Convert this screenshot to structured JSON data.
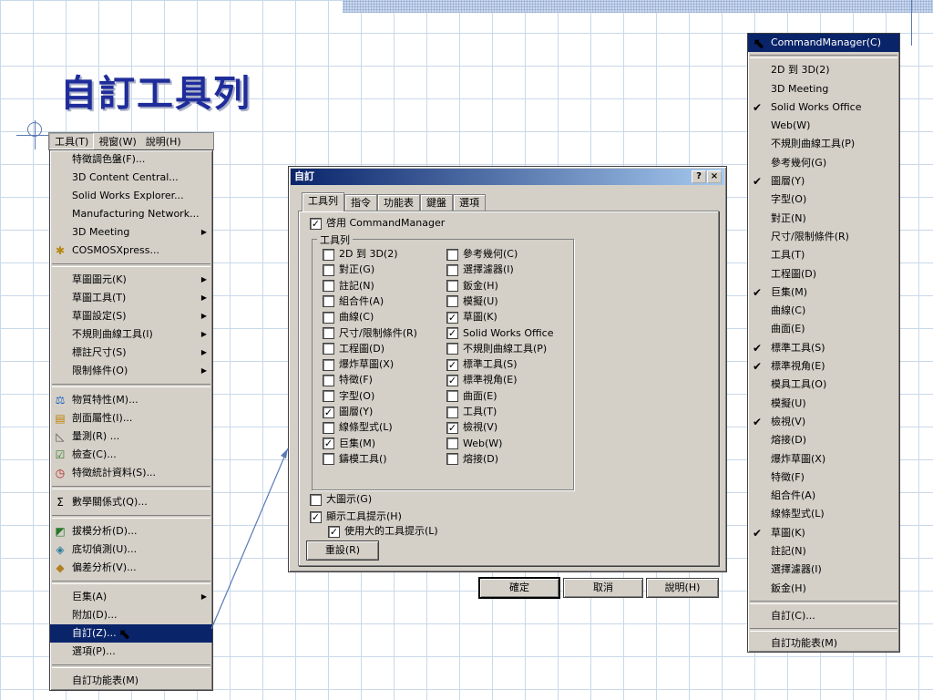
{
  "slide": {
    "title": "自訂工具列"
  },
  "menubar": {
    "items": [
      "工具(T)",
      "視窗(W)",
      "說明(H)"
    ]
  },
  "tools_menu": {
    "groups": [
      [
        {
          "label": "特徵調色盤(F)..."
        },
        {
          "label": "3D Content Central..."
        },
        {
          "label": "Solid Works Explorer..."
        },
        {
          "label": "Manufacturing Network..."
        },
        {
          "label": "3D Meeting",
          "submenu": true
        },
        {
          "label": "COSMOSXpress...",
          "icon": "cosmos-icon"
        }
      ],
      [
        {
          "label": "草圖圖元(K)",
          "submenu": true
        },
        {
          "label": "草圖工具(T)",
          "submenu": true
        },
        {
          "label": "草圖設定(S)",
          "submenu": true
        },
        {
          "label": "不規則曲線工具(I)",
          "submenu": true
        },
        {
          "label": "標註尺寸(S)",
          "submenu": true
        },
        {
          "label": "限制條件(O)",
          "submenu": true
        }
      ],
      [
        {
          "label": "物質特性(M)...",
          "icon": "mass-properties-icon"
        },
        {
          "label": "剖面屬性(I)...",
          "icon": "section-properties-icon"
        },
        {
          "label": "量測(R) ...",
          "icon": "measure-icon"
        },
        {
          "label": "檢查(C)...",
          "icon": "check-icon"
        },
        {
          "label": "特徵統計資料(S)...",
          "icon": "statistics-icon"
        }
      ],
      [
        {
          "label": "數學關係式(Q)...",
          "icon": "sigma-icon"
        }
      ],
      [
        {
          "label": "拔模分析(D)...",
          "icon": "draft-analysis-icon"
        },
        {
          "label": "底切偵測(U)...",
          "icon": "undercut-icon"
        },
        {
          "label": "偏差分析(V)...",
          "icon": "deviation-icon"
        }
      ],
      [
        {
          "label": "巨集(A)",
          "submenu": true
        },
        {
          "label": "附加(D)..."
        },
        {
          "label": "自訂(Z)...",
          "highlight": true
        },
        {
          "label": "選項(P)..."
        }
      ],
      [
        {
          "label": "自訂功能表(M)"
        }
      ]
    ]
  },
  "dialog": {
    "title": "自訂",
    "help_btn": "?",
    "close_btn": "×",
    "tabs": [
      "工具列",
      "指令",
      "功能表",
      "鍵盤",
      "選項"
    ],
    "enable_cm": {
      "label": "啓用 CommandManager",
      "checked": true
    },
    "group_label": "工具列",
    "toolbars_left": [
      {
        "label": "2D 到 3D(2)",
        "checked": false
      },
      {
        "label": "對正(G)",
        "checked": false
      },
      {
        "label": "註記(N)",
        "checked": false
      },
      {
        "label": "組合件(A)",
        "checked": false
      },
      {
        "label": "曲線(C)",
        "checked": false
      },
      {
        "label": "尺寸/限制條件(R)",
        "checked": false
      },
      {
        "label": "工程圖(D)",
        "checked": false
      },
      {
        "label": "爆炸草圖(X)",
        "checked": false
      },
      {
        "label": "特徵(F)",
        "checked": false
      },
      {
        "label": "字型(O)",
        "checked": false
      },
      {
        "label": "圖層(Y)",
        "checked": true
      },
      {
        "label": "線條型式(L)",
        "checked": false
      },
      {
        "label": "巨集(M)",
        "checked": true
      },
      {
        "label": "鑄模工具()",
        "checked": false
      }
    ],
    "toolbars_right": [
      {
        "label": "參考幾何(C)",
        "checked": false
      },
      {
        "label": "選擇濾器(I)",
        "checked": false
      },
      {
        "label": "鈑金(H)",
        "checked": false
      },
      {
        "label": "模擬(U)",
        "checked": false
      },
      {
        "label": "草圖(K)",
        "checked": true
      },
      {
        "label": "Solid Works Office",
        "checked": true
      },
      {
        "label": "不規則曲線工具(P)",
        "checked": false
      },
      {
        "label": "標準工具(S)",
        "checked": true
      },
      {
        "label": "標準視角(E)",
        "checked": true
      },
      {
        "label": "曲面(E)",
        "checked": false
      },
      {
        "label": "工具(T)",
        "checked": false
      },
      {
        "label": "檢視(V)",
        "checked": true
      },
      {
        "label": "Web(W)",
        "checked": false
      },
      {
        "label": "熔接(D)",
        "checked": false
      }
    ],
    "large_icons": {
      "label": "大圖示(G)",
      "checked": false
    },
    "show_tooltips": {
      "label": "顯示工具提示(H)",
      "checked": true
    },
    "large_tooltips": {
      "label": "使用大的工具提示(L)",
      "checked": true
    },
    "reset_btn": "重設(R)",
    "ok_btn": "確定",
    "cancel_btn": "取消",
    "help_button": "說明(H)"
  },
  "right_menu": {
    "items": [
      {
        "label": "CommandManager(C)",
        "checked": false,
        "highlight": true
      },
      {
        "sep": true
      },
      {
        "label": "2D 到 3D(2)",
        "checked": false
      },
      {
        "label": "3D Meeting",
        "checked": false
      },
      {
        "label": "Solid Works Office",
        "checked": true
      },
      {
        "label": "Web(W)",
        "checked": false
      },
      {
        "label": "不規則曲線工具(P)",
        "checked": false
      },
      {
        "label": "參考幾何(G)",
        "checked": false
      },
      {
        "label": "圖層(Y)",
        "checked": true
      },
      {
        "label": "字型(O)",
        "checked": false
      },
      {
        "label": "對正(N)",
        "checked": false
      },
      {
        "label": "尺寸/限制條件(R)",
        "checked": false
      },
      {
        "label": "工具(T)",
        "checked": false
      },
      {
        "label": "工程圖(D)",
        "checked": false
      },
      {
        "label": "巨集(M)",
        "checked": true
      },
      {
        "label": "曲線(C)",
        "checked": false
      },
      {
        "label": "曲面(E)",
        "checked": false
      },
      {
        "label": "標準工具(S)",
        "checked": true
      },
      {
        "label": "標準視角(E)",
        "checked": true
      },
      {
        "label": "模具工具(O)",
        "checked": false
      },
      {
        "label": "模擬(U)",
        "checked": false
      },
      {
        "label": "檢視(V)",
        "checked": true
      },
      {
        "label": "熔接(D)",
        "checked": false
      },
      {
        "label": "爆炸草圖(X)",
        "checked": false
      },
      {
        "label": "特徵(F)",
        "checked": false
      },
      {
        "label": "組合件(A)",
        "checked": false
      },
      {
        "label": "線條型式(L)",
        "checked": false
      },
      {
        "label": "草圖(K)",
        "checked": true
      },
      {
        "label": "註記(N)",
        "checked": false
      },
      {
        "label": "選擇濾器(I)",
        "checked": false
      },
      {
        "label": "鈑金(H)",
        "checked": false
      },
      {
        "sep": true
      },
      {
        "label": "自訂(C)...",
        "checked": false
      },
      {
        "sep": true
      },
      {
        "label": "自訂功能表(M)",
        "checked": false
      }
    ]
  },
  "colors": {
    "title": "#1f2d9a",
    "highlight": "#0a246a",
    "menu_bg": "#d4d0c8"
  }
}
